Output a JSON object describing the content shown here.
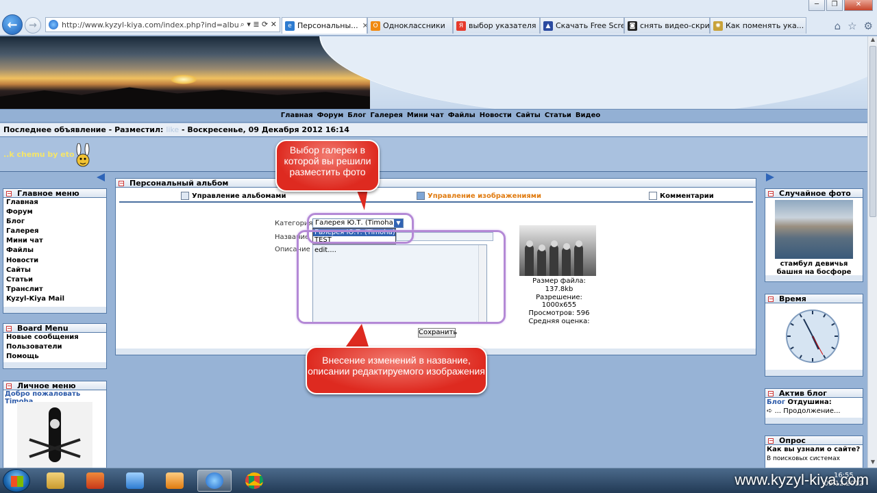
{
  "window_controls": {
    "minimize": "─",
    "maximize": "❐",
    "close": "✕"
  },
  "address": {
    "url": "http://www.kyzyl-kiya.com/index.php?ind=albu",
    "tools": "⌕ ▾ ≣ ⟳ ✕"
  },
  "tabs": [
    {
      "label": "Персональны...",
      "fav": "e",
      "color": "#2d7bd0",
      "active": true,
      "close": "✕"
    },
    {
      "label": "Одноклассники",
      "fav": "O",
      "color": "#f08a12"
    },
    {
      "label": "выбор указателя ...",
      "fav": "Я",
      "color": "#e63a2c"
    },
    {
      "label": "Скачать Free Scre...",
      "fav": "▲",
      "color": "#2b4aa0"
    },
    {
      "label": "снять видео-скри...",
      "fav": "◙",
      "color": "#222222"
    },
    {
      "label": "Как поменять ука...",
      "fav": "✺",
      "color": "#c8a23a"
    }
  ],
  "browser_icons": {
    "home": "⌂",
    "favorites": "☆",
    "settings": "⚙"
  },
  "topnav": [
    "Главная",
    "Форум",
    "Блог",
    "Галерея",
    "Мини чат",
    "Файлы",
    "Новости",
    "Сайты",
    "Статьи",
    "Видео"
  ],
  "announce": {
    "prefix": "Последнее объявление - Разместил:",
    "who": "like",
    "suffix": "- Воскресенье, 09 Декабря 2012 16:14"
  },
  "user": {
    "nick": "..k chemu by eto"
  },
  "main_menu": {
    "title": "Главное меню",
    "items": [
      "Главная",
      "Форум",
      "Блог",
      "Галерея",
      "Мини чат",
      "Файлы",
      "Новости",
      "Сайты",
      "Статьи",
      "Транслит",
      "Kyzyl-Kiya Mail"
    ]
  },
  "board_menu": {
    "title": "Board Menu",
    "items": [
      "Новые сообщения",
      "Пользователи",
      "Помощь"
    ]
  },
  "personal_menu": {
    "title": "Личное меню",
    "welcome": "Добро пожаловать Timoha"
  },
  "album": {
    "title": "Персональный альбом",
    "tools": [
      {
        "label": "Управление альбомами"
      },
      {
        "label": "Управление изображениями"
      },
      {
        "label": "Комментарии"
      }
    ],
    "form": {
      "category_label": "Категория",
      "category_value": "Галерея Ю.Т. (Timoha)",
      "category_options": [
        "Галерея Ю.Т. (Timoha)",
        "TEST"
      ],
      "name_label": "Название",
      "desc_label": "Описание",
      "desc_value": "edit....",
      "save": "Сохранить"
    },
    "photo_info": {
      "size": "Размер файла: 137.8kb",
      "resolution": "Разрешение: 1000x655",
      "views": "Просмотров: 596",
      "rating": "Средняя оценка:"
    }
  },
  "annotations": {
    "top": "Выбор галереи в которой вы решили разместить фото",
    "bottom": "Внесение изменений в название, описании редактируемого изображения"
  },
  "random_photo": {
    "title": "Случайное фото",
    "caption": "стамбул девичья башня на босфоре"
  },
  "time": {
    "title": "Время"
  },
  "blog": {
    "title": "Актив блог",
    "prefix": "Блог",
    "name": "Отдушина:",
    "more": "... Продолжение..."
  },
  "poll": {
    "title": "Опрос",
    "question": "Как вы узнали о сайте?",
    "option1": "В поисковых системах"
  },
  "watermark": "www.kyzyl-kiya.com",
  "clock": {
    "time": "16:55",
    "date": "09.12.2012"
  }
}
